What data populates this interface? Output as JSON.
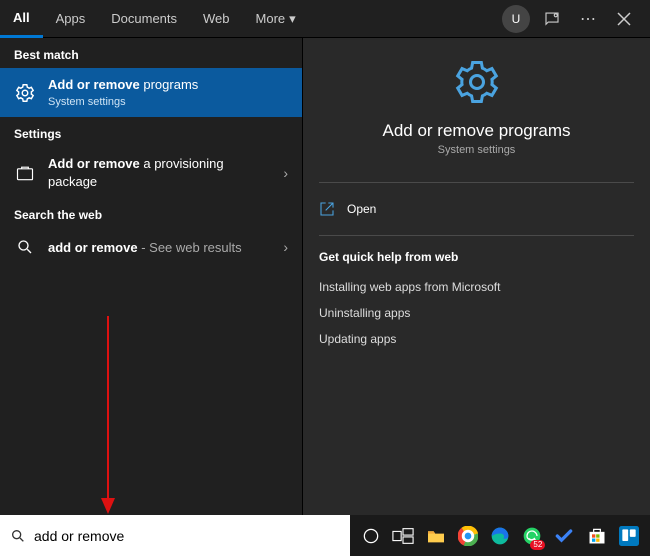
{
  "tabs": {
    "all": "All",
    "apps": "Apps",
    "documents": "Documents",
    "web": "Web",
    "more": "More"
  },
  "user_initial": "U",
  "left": {
    "best_match_label": "Best match",
    "result1_bold": "Add or remove",
    "result1_rest": " programs",
    "result1_sub": "System settings",
    "settings_label": "Settings",
    "result2_bold": "Add or remove",
    "result2_rest": " a provisioning package",
    "web_label": "Search the web",
    "result3_bold": "add or remove",
    "result3_rest": " - See web results"
  },
  "detail": {
    "title": "Add or remove programs",
    "sub": "System settings",
    "open": "Open",
    "help_title": "Get quick help from web",
    "help1": "Installing web apps from Microsoft",
    "help2": "Uninstalling apps",
    "help3": "Updating apps"
  },
  "search": {
    "value": "add or remove"
  },
  "whatsapp_badge": "52"
}
